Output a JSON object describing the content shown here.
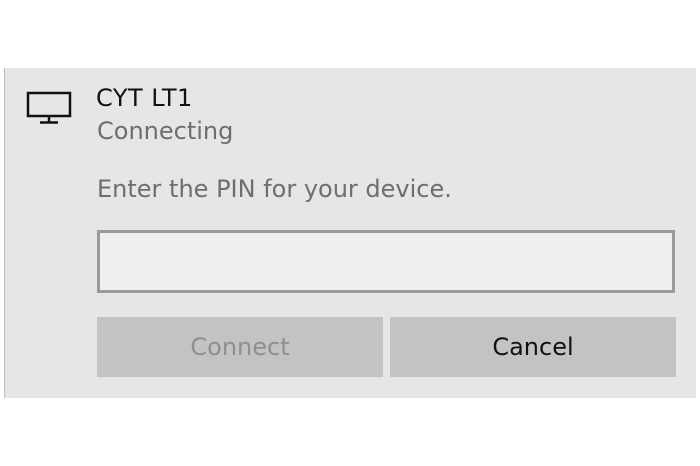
{
  "device": {
    "icon": "monitor-icon",
    "name": "CYT LT1",
    "status": "Connecting"
  },
  "pin": {
    "prompt": "Enter the PIN for your device.",
    "value": "",
    "placeholder": ""
  },
  "buttons": {
    "connect_label": "Connect",
    "connect_enabled": false,
    "cancel_label": "Cancel"
  },
  "colors": {
    "panel_background": "#e6e6e6",
    "button_background": "#c3c3c3",
    "disabled_text": "#8f8f8f",
    "secondary_text": "#6e6e6e"
  }
}
